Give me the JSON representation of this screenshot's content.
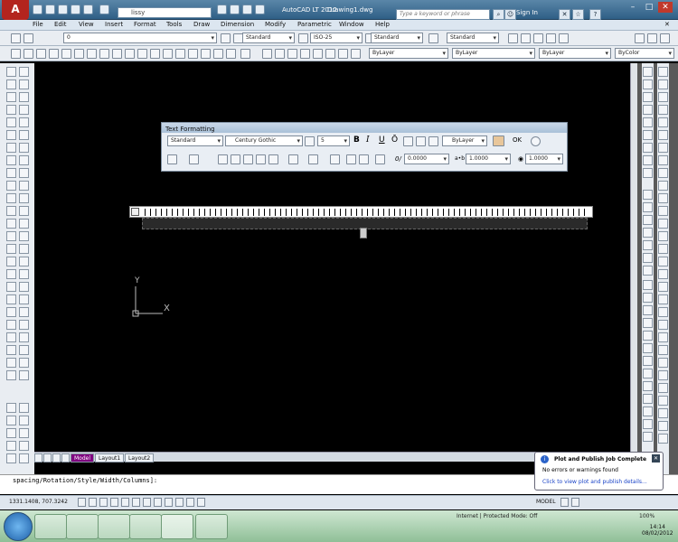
{
  "window": {
    "app_title": "AutoCAD LT 2012",
    "document": "Drawing1.dwg",
    "workspace": "lissy",
    "search_placeholder": "Type a keyword or phrase",
    "sign_in": "Sign In"
  },
  "menu": [
    "File",
    "Edit",
    "View",
    "Insert",
    "Format",
    "Tools",
    "Draw",
    "Dimension",
    "Modify",
    "Parametric",
    "Window",
    "Help"
  ],
  "toolbar": {
    "layer_value": "0",
    "text_style": "Standard",
    "dim_style": "ISO-25",
    "table_style": "Standard",
    "mleader_style": "Standard",
    "color": "ByLayer",
    "linetype": "ByLayer",
    "lineweight": "ByLayer",
    "plotstyle": "ByColor"
  },
  "text_formatting": {
    "title": "Text Formatting",
    "style": "Standard",
    "font": "Century Gothic",
    "height": "5",
    "bold": "B",
    "italic": "I",
    "underline": "U",
    "overline": "Ō",
    "color": "ByLayer",
    "ok": "OK",
    "oblique": "0.0000",
    "tracking": "1.0000",
    "width": "1.0000"
  },
  "ucs": {
    "y": "Y",
    "x": "X"
  },
  "layout_tabs": [
    "Model",
    "Layout1",
    "Layout2"
  ],
  "command_line": "spacing/Rotation/Style/Width/Columns]:",
  "status": {
    "coords": "1331.1408, 707.3242",
    "model": "MODEL"
  },
  "notification": {
    "title": "Plot and Publish Job Complete",
    "message": "No errors or warnings found",
    "link": "Click to view plot and publish details..."
  },
  "taskbar": {
    "ie_status": "Internet | Protected Mode: Off",
    "zoom": "100%",
    "time": "14:14",
    "date": "08/02/2012"
  },
  "colors": {
    "accent": "#b3241e",
    "titlebar": "#2f5f86",
    "canvas": "#000000"
  }
}
